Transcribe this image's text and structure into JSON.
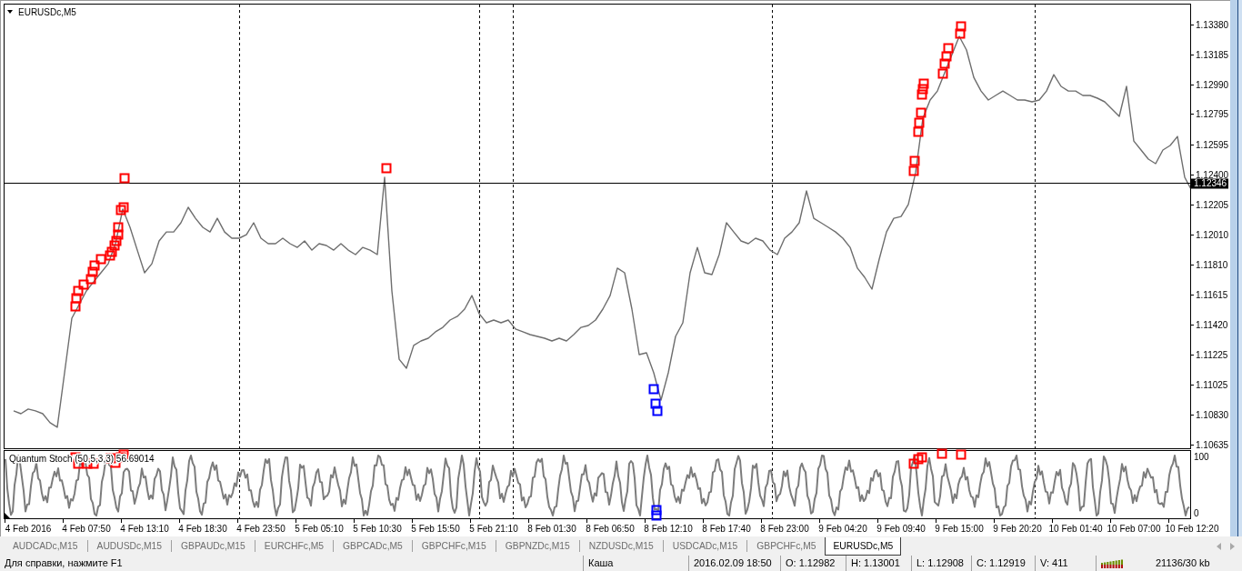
{
  "chart_window": {
    "title": "EURUSDc,M5",
    "chart_data": {
      "type": "line",
      "categories": [
        null,
        null,
        "4 Feb 2016",
        null,
        null,
        null,
        null,
        null,
        null,
        null,
        "4 Feb 07:50",
        null,
        null,
        null,
        null,
        null,
        null,
        null,
        "4 Feb 13:10",
        null,
        null,
        null,
        null,
        null,
        null,
        null,
        "4 Feb 18:30",
        null,
        null,
        null,
        null,
        null,
        null,
        null,
        "4 Feb 23:50",
        null,
        null,
        null,
        null,
        null,
        null,
        null,
        "5 Feb 05:10",
        null,
        null,
        null,
        null,
        null,
        null,
        null,
        "5 Feb 10:30",
        null,
        null,
        null,
        null,
        null,
        null,
        null,
        "5 Feb 15:50",
        null,
        null,
        null,
        null,
        null,
        null,
        null,
        "5 Feb 21:10",
        null,
        null,
        null,
        null,
        null,
        null,
        null,
        "8 Feb 01:30",
        null,
        null,
        null,
        null,
        null,
        null,
        null,
        "8 Feb 06:50",
        null,
        null,
        null,
        null,
        null,
        null,
        null,
        "8 Feb 12:10",
        null,
        null,
        null,
        null,
        null,
        null,
        null,
        "8 Feb 17:40",
        null,
        null,
        null,
        null,
        null,
        null,
        null,
        "8 Feb 23:00",
        null,
        null,
        null,
        null,
        null,
        null,
        null,
        "9 Feb 04:20",
        null,
        null,
        null,
        null,
        null,
        null,
        null,
        "9 Feb 09:40",
        null,
        null,
        null,
        null,
        null,
        null,
        null,
        "9 Feb 15:00",
        null,
        null,
        null,
        null,
        null,
        null,
        null,
        "9 Feb 20:20",
        null,
        null,
        null,
        null,
        null,
        null,
        null,
        "10 Feb 01:40",
        null,
        null,
        null,
        null,
        null,
        null,
        null,
        "10 Feb 07:00",
        null,
        null,
        null,
        null,
        null,
        null,
        null,
        "10 Feb 12:20"
      ],
      "ylim": [
        1.10611,
        1.13511
      ],
      "yticks": [
        {
          "value": 1.1338,
          "label": "1.13380"
        },
        {
          "value": 1.13185,
          "label": "1.13185"
        },
        {
          "value": 1.1299,
          "label": "1.12990"
        },
        {
          "value": 1.12795,
          "label": "1.12795"
        },
        {
          "value": 1.12595,
          "label": "1.12595"
        },
        {
          "value": 1.124,
          "label": "1.12400"
        },
        {
          "value": 1.12205,
          "label": "1.12205"
        },
        {
          "value": 1.1201,
          "label": "1.12010"
        },
        {
          "value": 1.1181,
          "label": "1.11810"
        },
        {
          "value": 1.11615,
          "label": "1.11615"
        },
        {
          "value": 1.1142,
          "label": "1.11420"
        },
        {
          "value": 1.11225,
          "label": "1.11225"
        },
        {
          "value": 1.11025,
          "label": "1.11025"
        },
        {
          "value": 1.1083,
          "label": "1.10830"
        },
        {
          "value": 1.10635,
          "label": "1.10635"
        }
      ],
      "values": [
        1.10855,
        1.10837,
        1.10867,
        1.10855,
        1.10837,
        1.10778,
        1.10748,
        1.11104,
        1.11461,
        1.1155,
        1.11639,
        1.11699,
        1.11758,
        1.11817,
        1.11948,
        1.12174,
        1.12055,
        1.11906,
        1.11758,
        1.11817,
        1.11966,
        1.12025,
        1.12025,
        1.12085,
        1.12186,
        1.12114,
        1.12055,
        1.12025,
        1.12114,
        1.12025,
        1.11984,
        1.11984,
        1.12007,
        1.12085,
        1.11984,
        1.11948,
        1.11948,
        1.11984,
        1.11948,
        1.11924,
        1.11966,
        1.11906,
        1.11948,
        1.11936,
        1.11906,
        1.11948,
        1.11906,
        1.11877,
        1.11924,
        1.11906,
        1.11877,
        1.12382,
        1.11639,
        1.11193,
        1.11134,
        1.11283,
        1.11312,
        1.1133,
        1.11372,
        1.11401,
        1.11449,
        1.11473,
        1.1152,
        1.11609,
        1.11491,
        1.11431,
        1.11449,
        1.11431,
        1.11449,
        1.1139,
        1.11372,
        1.11354,
        1.11342,
        1.1133,
        1.11312,
        1.1133,
        1.11312,
        1.11354,
        1.11401,
        1.11413,
        1.11449,
        1.1152,
        1.11609,
        1.11788,
        1.11758,
        1.1152,
        1.11223,
        1.11235,
        1.11104,
        1.10926,
        1.11104,
        1.11342,
        1.11431,
        1.11758,
        1.11924,
        1.11758,
        1.11746,
        1.11877,
        1.12085,
        1.12025,
        1.11966,
        1.11948,
        1.11984,
        1.11966,
        1.11906,
        1.11877,
        1.11984,
        1.12025,
        1.12085,
        1.12293,
        1.12114,
        1.12085,
        1.12055,
        1.12025,
        1.11984,
        1.11924,
        1.11788,
        1.11728,
        1.11651,
        1.11847,
        1.12025,
        1.12114,
        1.12126,
        1.12204,
        1.12412,
        1.12768,
        1.12887,
        1.12946,
        1.13065,
        1.13184,
        1.13303,
        1.13214,
        1.13035,
        1.12946,
        1.12887,
        1.12917,
        1.12946,
        1.12917,
        1.12887,
        1.12887,
        1.12875,
        1.12887,
        1.12946,
        1.13053,
        1.12976,
        1.12946,
        1.12946,
        1.12917,
        1.12917,
        1.12899,
        1.12875,
        1.12827,
        1.1278,
        1.12976,
        1.12619,
        1.1256,
        1.12501,
        1.12471,
        1.1256,
        1.1259,
        1.12649,
        1.12382,
        1.12293
      ],
      "ref_lines": [
        {
          "axis": "y",
          "value": 1.12346,
          "label": "1.12346"
        }
      ]
    },
    "signals": [
      {
        "color": "#ff0000"
      },
      {
        "color": "#ff0000"
      },
      {
        "color": "#ff0000"
      },
      {
        "color": "#ff0000"
      },
      {
        "color": "#ff0000"
      },
      {
        "color": "#ff0000"
      },
      {
        "color": "#ff0000"
      },
      {
        "color": "#ff0000"
      },
      {
        "color": "#ff0000"
      },
      {
        "color": "#ff0000"
      },
      {
        "color": "#ff0000"
      },
      {
        "color": "#ff0000"
      },
      {
        "color": "#ff0000"
      },
      {
        "color": "#ff0000"
      },
      {
        "color": "#ff0000"
      },
      {
        "color": "#ff0000"
      },
      {
        "color": "#ff0000"
      },
      {
        "color": "#ff0000"
      },
      {
        "color": "#0000ff"
      },
      {
        "color": "#0000ff"
      },
      {
        "color": "#0000ff"
      },
      {
        "color": "#ff0000"
      },
      {
        "color": "#ff0000"
      },
      {
        "color": "#ff0000"
      },
      {
        "color": "#ff0000"
      },
      {
        "color": "#ff0000"
      },
      {
        "color": "#ff0000"
      },
      {
        "color": "#ff0000"
      },
      {
        "color": "#ff0000"
      },
      {
        "color": "#ff0000"
      },
      {
        "color": "#ff0000"
      },
      {
        "color": "#ff0000"
      },
      {
        "color": "#ff0000"
      },
      {
        "color": "#ff0000"
      },
      {
        "color": "#ff0000"
      }
    ]
  },
  "indicator": {
    "label": "Quantum Stoch (50,5,3,3) 56.69014",
    "axis_labels": [
      "100",
      "0"
    ],
    "markers": [
      {
        "color": "#ff0000"
      },
      {
        "color": "#ff0000"
      },
      {
        "color": "#ff0000"
      },
      {
        "color": "#ff0000"
      },
      {
        "color": "#ff0000"
      },
      {
        "color": "#ff0000"
      },
      {
        "color": "#ff0000"
      },
      {
        "color": "#ff0000"
      },
      {
        "color": "#0000ff"
      },
      {
        "color": "#0000ff"
      },
      {
        "color": "#ff0000"
      },
      {
        "color": "#ff0000"
      },
      {
        "color": "#ff0000"
      },
      {
        "color": "#ff0000"
      },
      {
        "color": "#ff0000"
      }
    ]
  },
  "tabs": [
    {
      "label": "AUDCADc,M15",
      "selected": false
    },
    {
      "label": "AUDUSDc,M15",
      "selected": false
    },
    {
      "label": "GBPAUDc,M15",
      "selected": false
    },
    {
      "label": "EURCHFc,M5",
      "selected": false
    },
    {
      "label": "GBPCADc,M5",
      "selected": false
    },
    {
      "label": "GBPCHFc,M15",
      "selected": false
    },
    {
      "label": "GBPNZDc,M15",
      "selected": false
    },
    {
      "label": "NZDUSDc,M15",
      "selected": false
    },
    {
      "label": "USDCADc,M15",
      "selected": false
    },
    {
      "label": "GBPCHFc,M5",
      "selected": false
    },
    {
      "label": "EURUSDc,M5",
      "selected": true
    }
  ],
  "status_bar": {
    "cells": [
      "Для справки, нажмите F1",
      "Каша",
      "2016.02.09 18:50",
      "O: 1.12982",
      "H: 1.13001",
      "L: 1.12908",
      "C: 1.12919",
      "V: 411"
    ],
    "traffic": "21136/30 kb"
  }
}
